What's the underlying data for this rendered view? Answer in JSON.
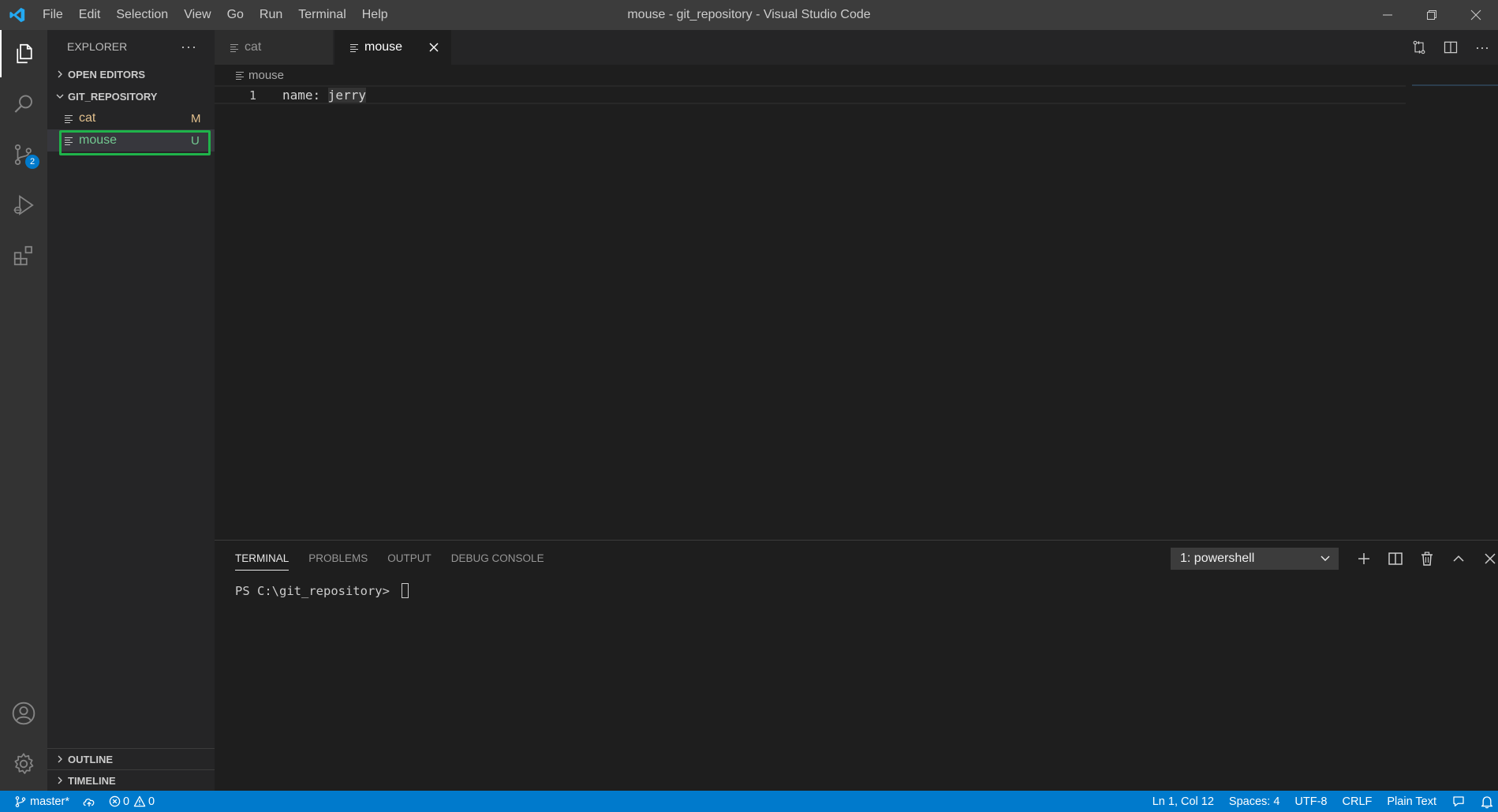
{
  "window": {
    "title": "mouse - git_repository - Visual Studio Code",
    "menu": [
      "File",
      "Edit",
      "Selection",
      "View",
      "Go",
      "Run",
      "Terminal",
      "Help"
    ]
  },
  "activity": {
    "source_control_badge": "2"
  },
  "sidebar": {
    "title": "EXPLORER",
    "more": "···",
    "open_editors": "OPEN EDITORS",
    "folder": "GIT_REPOSITORY",
    "files": [
      {
        "name": "cat",
        "status": "M",
        "color": "#e2c08d"
      },
      {
        "name": "mouse",
        "status": "U",
        "color": "#73c991"
      }
    ],
    "outline": "OUTLINE",
    "timeline": "TIMELINE"
  },
  "editor": {
    "tabs": [
      {
        "label": "cat"
      },
      {
        "label": "mouse"
      }
    ],
    "breadcrumb": "mouse",
    "line_number": "1",
    "code_key": "name: ",
    "code_value": "jerry",
    "more_actions": "···"
  },
  "panel": {
    "tabs": [
      "TERMINAL",
      "PROBLEMS",
      "OUTPUT",
      "DEBUG CONSOLE"
    ],
    "terminal_select": "1: powershell",
    "prompt": "PS C:\\git_repository> "
  },
  "statusbar": {
    "branch": "master*",
    "errors": "0",
    "warnings": "0",
    "position": "Ln 1, Col 12",
    "spaces": "Spaces: 4",
    "encoding": "UTF-8",
    "eol": "CRLF",
    "language": "Plain Text"
  },
  "colors": {
    "accent": "#007acc",
    "selection_outline": "#1fb34a"
  }
}
